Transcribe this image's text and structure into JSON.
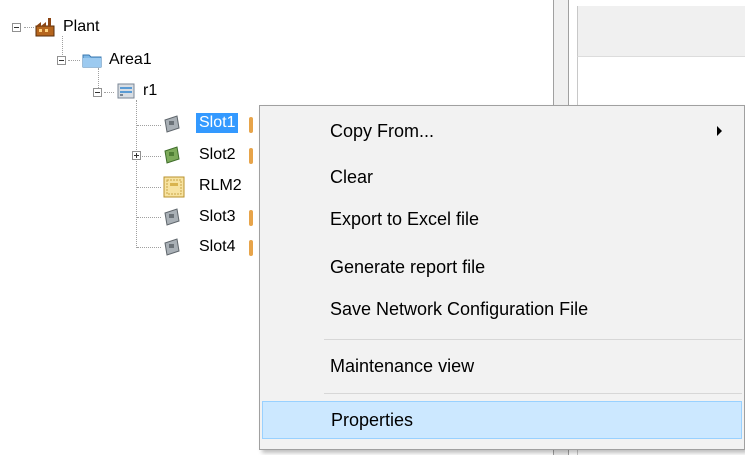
{
  "tree": {
    "nodes": [
      {
        "label": "Plant",
        "icon": "plant-icon"
      },
      {
        "label": "Area1",
        "icon": "folder-icon"
      },
      {
        "label": "r1",
        "icon": "rack-icon"
      },
      {
        "label": "Slot1",
        "icon": "module-card-icon",
        "selected": true
      },
      {
        "label": "Slot2",
        "icon": "module-card-icon"
      },
      {
        "label": "RLM2",
        "icon": "rlm-module-icon"
      },
      {
        "label": "Slot3",
        "icon": "module-card-icon"
      },
      {
        "label": "Slot4",
        "icon": "module-card-icon"
      }
    ]
  },
  "context_menu": {
    "items": [
      {
        "label": "Copy From...",
        "has_submenu": true
      },
      {
        "label": "Clear"
      },
      {
        "label": "Export to Excel file"
      },
      {
        "label": "Generate report file"
      },
      {
        "label": "Save Network Configuration File"
      },
      {
        "label": "Maintenance view"
      },
      {
        "label": "Properties",
        "highlighted": true
      }
    ]
  },
  "colors": {
    "selection": "#3399ff",
    "menu_highlight": "#cce8ff",
    "menu_highlight_border": "#99d1ff"
  }
}
